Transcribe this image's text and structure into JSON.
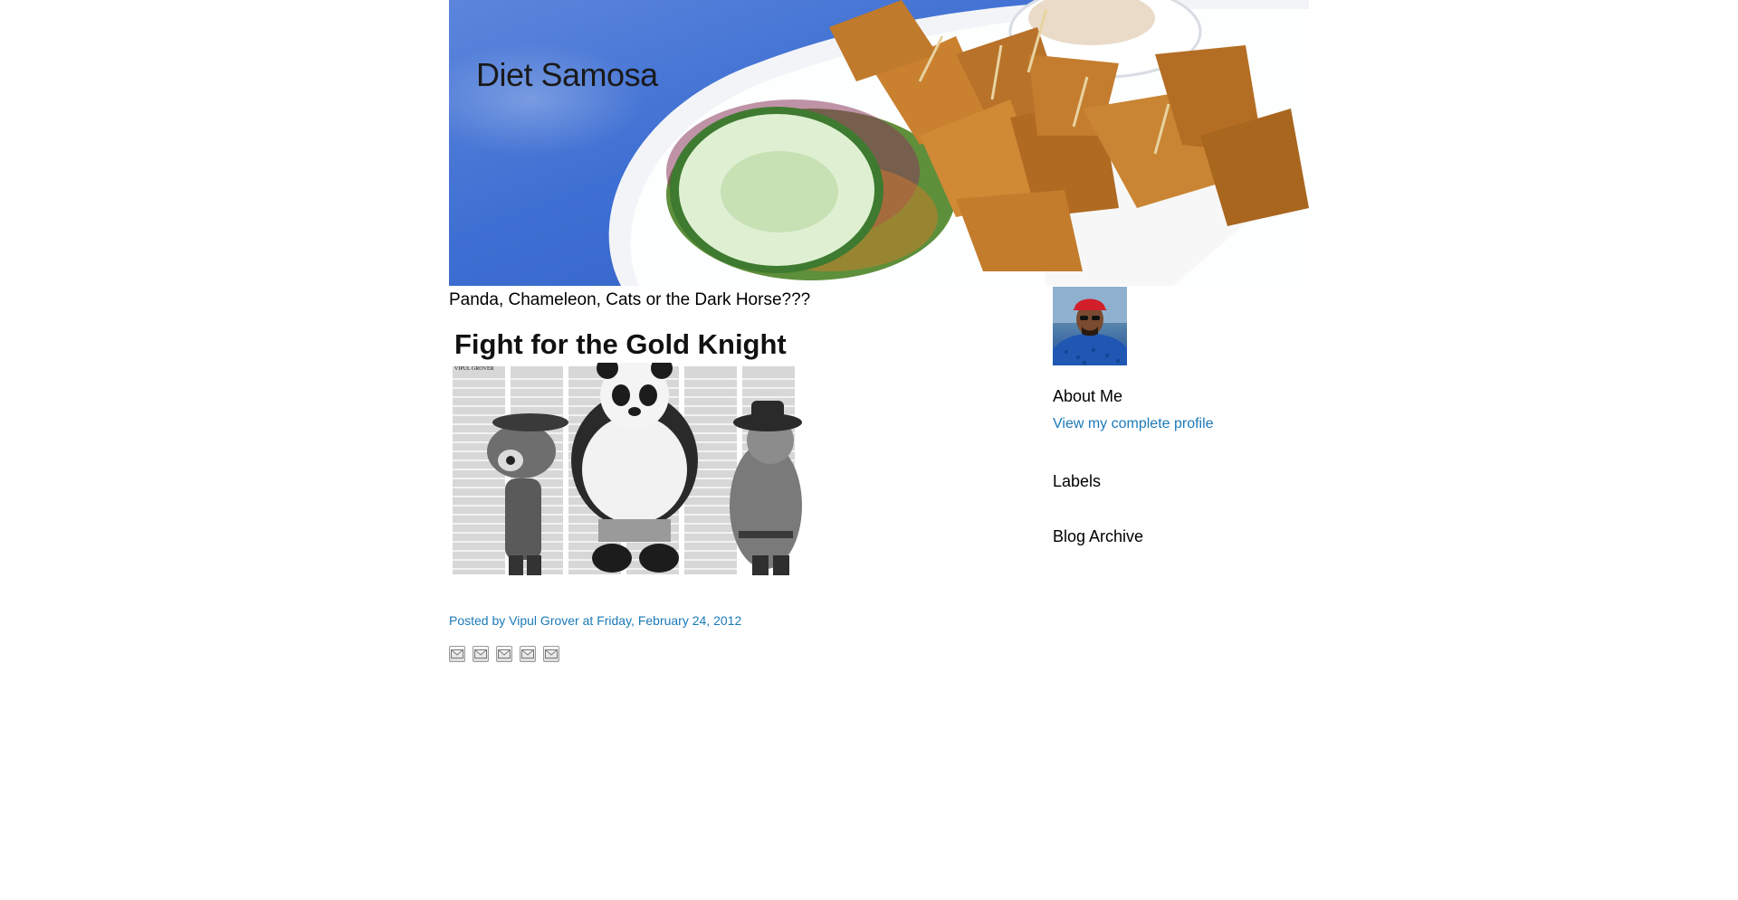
{
  "header": {
    "blog_title": "Diet Samosa"
  },
  "post": {
    "title": "Panda, Chameleon, Cats or the Dark Horse???",
    "image": {
      "headline": "Fight for the Gold Knight",
      "byline": "VIPUL GROVER"
    },
    "footer": {
      "posted_by_label": "Posted by",
      "author": "Vipul Grover",
      "at_label": "at",
      "date": "Friday, February 24, 2012"
    },
    "share_icons": [
      "email-share-icon",
      "blog-this-icon",
      "twitter-share-icon",
      "facebook-share-icon",
      "pinterest-share-icon"
    ]
  },
  "sidebar": {
    "about_title": "About Me",
    "profile_link": "View my complete profile",
    "labels_title": "Labels",
    "archive_title": "Blog Archive"
  },
  "colors": {
    "link": "#1b7ab8",
    "banner_blue": "#3e6fd2"
  }
}
